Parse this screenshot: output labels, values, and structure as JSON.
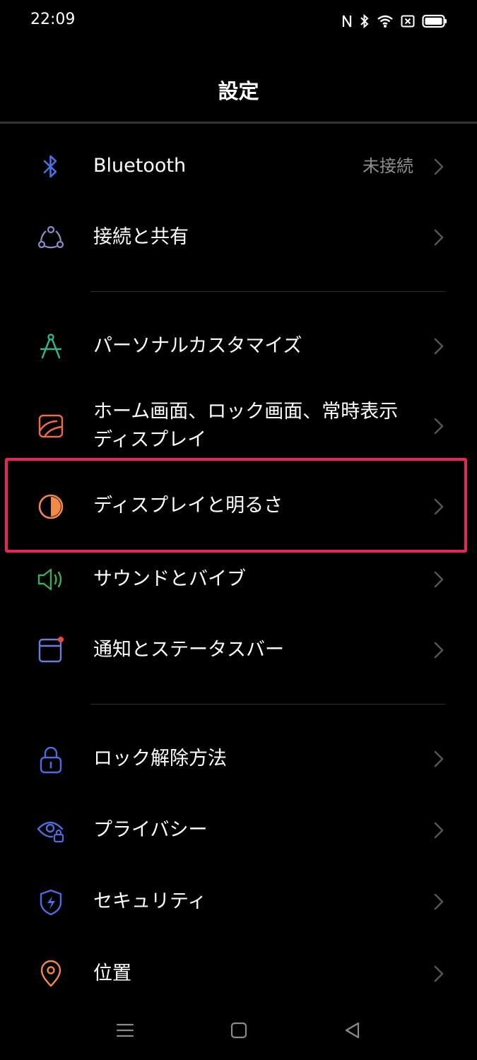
{
  "status_bar": {
    "time": "22:09",
    "icons": [
      "nfc-icon",
      "bluetooth-status-icon",
      "wifi-icon",
      "sim-off-icon",
      "battery-icon"
    ]
  },
  "header": {
    "title": "設定"
  },
  "items": [
    {
      "label": "Bluetooth",
      "value": "未接続",
      "icon": "bluetooth-icon",
      "icon_color": "#4a6ee0"
    },
    {
      "label": "接続と共有",
      "icon": "connection-share-icon",
      "icon_color": "#8a8fc7"
    },
    {
      "label": "パーソナルカスタマイズ",
      "icon": "compass-icon",
      "icon_color": "#35b58f"
    },
    {
      "label": "ホーム画面、ロック画面、常時表示ディスプレイ",
      "icon": "wallpaper-icon",
      "icon_color": "#ee6b45"
    },
    {
      "label": "ディスプレイと明るさ",
      "icon": "brightness-icon",
      "icon_color": "#f0894a"
    },
    {
      "label": "サウンドとバイブ",
      "icon": "speaker-icon",
      "icon_color": "#3fae58"
    },
    {
      "label": "通知とステータスバー",
      "icon": "notification-icon",
      "icon_color": "#6a7bd8"
    },
    {
      "label": "ロック解除方法",
      "icon": "lock-icon",
      "icon_color": "#4a6ee0"
    },
    {
      "label": "プライバシー",
      "icon": "privacy-eye-icon",
      "icon_color": "#4a6ee0"
    },
    {
      "label": "セキュリティ",
      "icon": "shield-icon",
      "icon_color": "#4a6ee0"
    },
    {
      "label": "位置",
      "icon": "location-icon",
      "icon_color": "#f0894a"
    }
  ],
  "highlight_color": "#e8255b",
  "nav_bar": {
    "buttons": [
      "menu-icon",
      "home-icon",
      "back-icon"
    ]
  }
}
